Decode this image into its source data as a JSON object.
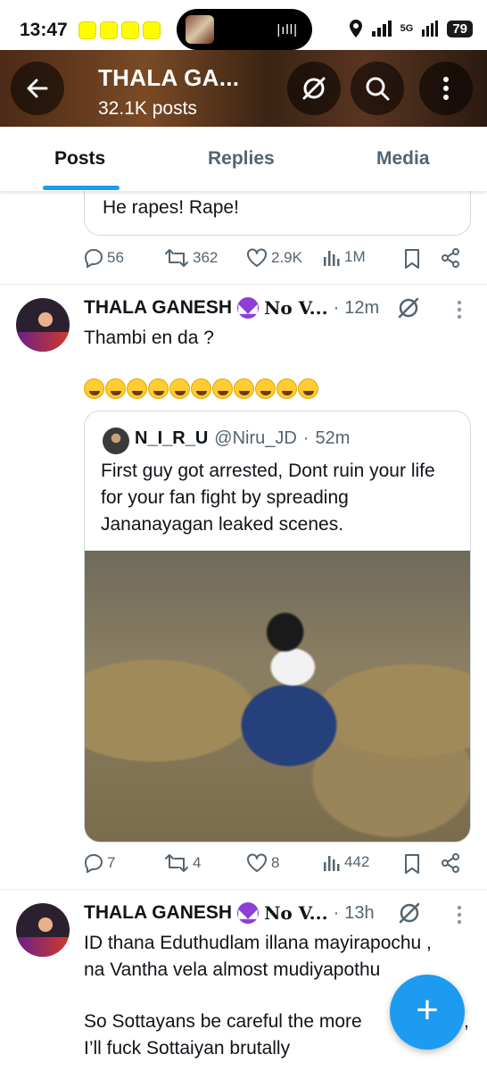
{
  "status_bar": {
    "time": "13:47",
    "network": "5G",
    "battery": "79"
  },
  "header": {
    "title": "THALA GA...",
    "subtitle": "32.1K posts"
  },
  "tabs": [
    {
      "label": "Posts",
      "active": true
    },
    {
      "label": "Replies",
      "active": false
    },
    {
      "label": "Media",
      "active": false
    }
  ],
  "prev_post": {
    "quote_text": "He rapes! Rape!",
    "replies": "56",
    "reposts": "362",
    "likes": "2.9K",
    "views": "1M"
  },
  "post1": {
    "author": "THALA GANESH",
    "author_suffix": "No V...",
    "time": "12m",
    "text": "Thambi en da ?",
    "quote": {
      "author": "N_I_R_U",
      "handle": "@Niru_JD",
      "time": "52m",
      "text": "First guy got arrested, Dont ruin your life for your fan fight by spreading Jananayagan leaked scenes."
    },
    "replies": "7",
    "reposts": "4",
    "likes": "8",
    "views": "442"
  },
  "post2": {
    "author": "THALA GANESH",
    "author_suffix": "No V...",
    "time": "13h",
    "line1": "ID thana Eduthudlam illana mayirapochu ,",
    "line2": "na Vantha vela almost mudiyapothu",
    "line3": "So Sottayans be careful the more",
    "line3_end": ",",
    "line4": "I’ll fuck Sottaiyan brutally"
  },
  "fab_label": "+",
  "colors": {
    "accent": "#1d9bf0",
    "text": "#0f1419",
    "muted": "#536471"
  }
}
